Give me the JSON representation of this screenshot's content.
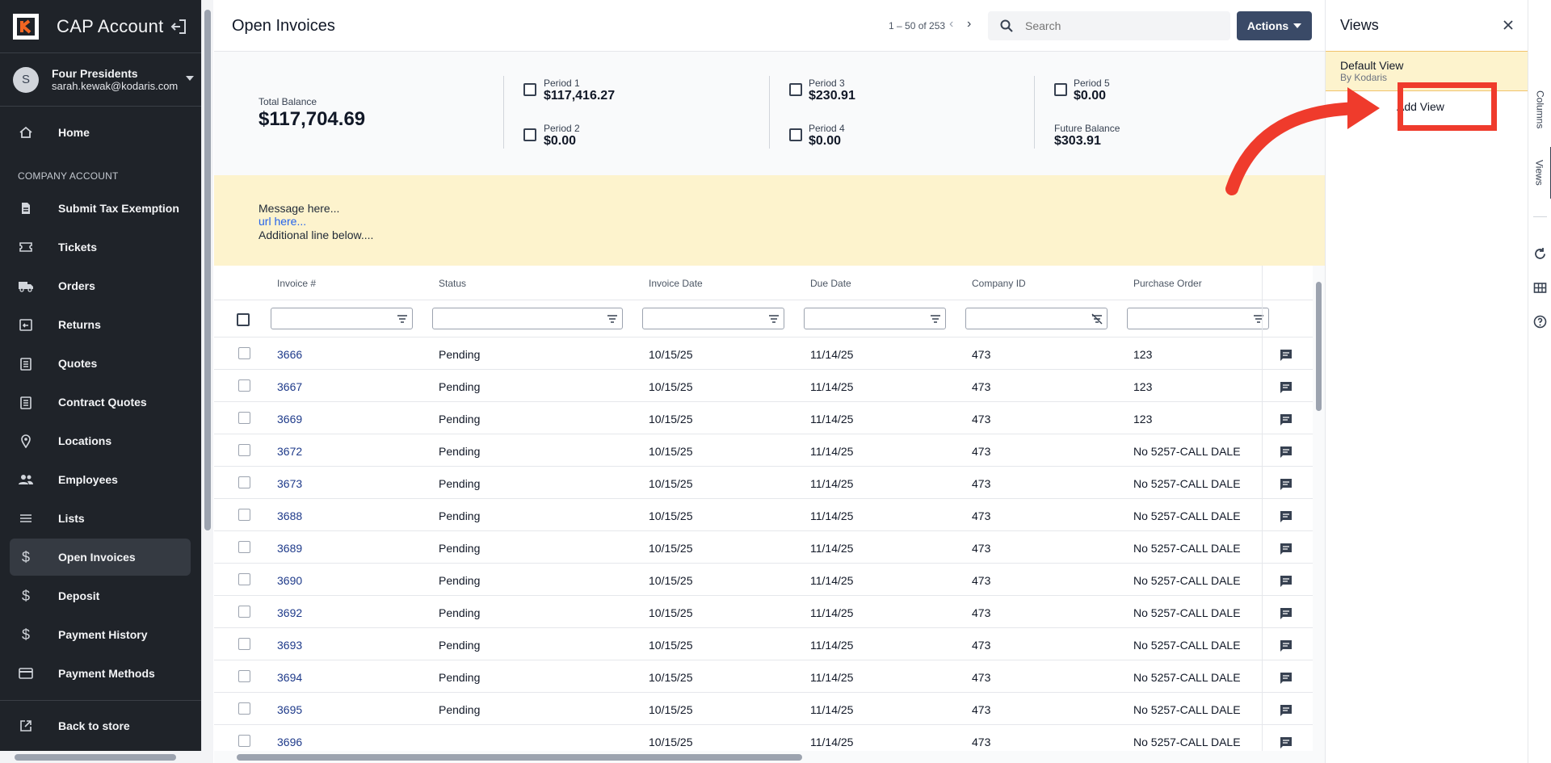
{
  "sidebar": {
    "app_title": "CAP Account",
    "user": {
      "initial": "S",
      "name": "Four Presidents",
      "email": "sarah.kewak@kodaris.com"
    },
    "home_label": "Home",
    "section_label": "COMPANY ACCOUNT",
    "items": [
      {
        "label": "Submit Tax Exemption",
        "icon": "document-icon"
      },
      {
        "label": "Tickets",
        "icon": "ticket-icon"
      },
      {
        "label": "Orders",
        "icon": "truck-icon"
      },
      {
        "label": "Returns",
        "icon": "return-icon"
      },
      {
        "label": "Quotes",
        "icon": "clipboard-icon"
      },
      {
        "label": "Contract Quotes",
        "icon": "clipboard-icon"
      },
      {
        "label": "Locations",
        "icon": "location-pin-icon"
      },
      {
        "label": "Employees",
        "icon": "people-icon"
      },
      {
        "label": "Lists",
        "icon": "list-icon"
      },
      {
        "label": "Open Invoices",
        "icon": "dollar-icon",
        "active": true
      },
      {
        "label": "Deposit",
        "icon": "dollar-icon"
      },
      {
        "label": "Payment History",
        "icon": "dollar-icon"
      },
      {
        "label": "Payment Methods",
        "icon": "credit-card-icon"
      }
    ],
    "back_label": "Back to store"
  },
  "topbar": {
    "title": "Open Invoices",
    "pager": "1 – 50 of 253",
    "search_placeholder": "Search",
    "actions_label": "Actions"
  },
  "summary": {
    "total_label": "Total Balance",
    "total_value": "$117,704.69",
    "period1_label": "Period 1",
    "period1_value": "$117,416.27",
    "period2_label": "Period 2",
    "period2_value": "$0.00",
    "period3_label": "Period 3",
    "period3_value": "$230.91",
    "period4_label": "Period 4",
    "period4_value": "$0.00",
    "period5_label": "Period 5",
    "period5_value": "$0.00",
    "future_label": "Future Balance",
    "future_value": "$303.91"
  },
  "message": {
    "line1": "Message here...",
    "link": "url here...",
    "line3": "Additional line below...."
  },
  "table": {
    "columns": [
      "Invoice #",
      "Status",
      "Invoice Date",
      "Due Date",
      "Company ID",
      "Purchase Order"
    ],
    "rows": [
      {
        "invoice": "3666",
        "status": "Pending",
        "invoice_date": "10/15/25",
        "due_date": "11/14/25",
        "company_id": "473",
        "po": "123"
      },
      {
        "invoice": "3667",
        "status": "Pending",
        "invoice_date": "10/15/25",
        "due_date": "11/14/25",
        "company_id": "473",
        "po": "123"
      },
      {
        "invoice": "3669",
        "status": "Pending",
        "invoice_date": "10/15/25",
        "due_date": "11/14/25",
        "company_id": "473",
        "po": "123"
      },
      {
        "invoice": "3672",
        "status": "Pending",
        "invoice_date": "10/15/25",
        "due_date": "11/14/25",
        "company_id": "473",
        "po": "No 5257-CALL DALE"
      },
      {
        "invoice": "3673",
        "status": "Pending",
        "invoice_date": "10/15/25",
        "due_date": "11/14/25",
        "company_id": "473",
        "po": "No 5257-CALL DALE"
      },
      {
        "invoice": "3688",
        "status": "Pending",
        "invoice_date": "10/15/25",
        "due_date": "11/14/25",
        "company_id": "473",
        "po": "No 5257-CALL DALE"
      },
      {
        "invoice": "3689",
        "status": "Pending",
        "invoice_date": "10/15/25",
        "due_date": "11/14/25",
        "company_id": "473",
        "po": "No 5257-CALL DALE"
      },
      {
        "invoice": "3690",
        "status": "Pending",
        "invoice_date": "10/15/25",
        "due_date": "11/14/25",
        "company_id": "473",
        "po": "No 5257-CALL DALE"
      },
      {
        "invoice": "3692",
        "status": "Pending",
        "invoice_date": "10/15/25",
        "due_date": "11/14/25",
        "company_id": "473",
        "po": "No 5257-CALL DALE"
      },
      {
        "invoice": "3693",
        "status": "Pending",
        "invoice_date": "10/15/25",
        "due_date": "11/14/25",
        "company_id": "473",
        "po": "No 5257-CALL DALE"
      },
      {
        "invoice": "3694",
        "status": "Pending",
        "invoice_date": "10/15/25",
        "due_date": "11/14/25",
        "company_id": "473",
        "po": "No 5257-CALL DALE"
      },
      {
        "invoice": "3695",
        "status": "Pending",
        "invoice_date": "10/15/25",
        "due_date": "11/14/25",
        "company_id": "473",
        "po": "No 5257-CALL DALE"
      },
      {
        "invoice": "3696",
        "status": "",
        "invoice_date": "10/15/25",
        "due_date": "11/14/25",
        "company_id": "473",
        "po": "No 5257-CALL DALE"
      }
    ]
  },
  "views_panel": {
    "title": "Views",
    "default_view_name": "Default View",
    "default_view_by": "By Kodaris",
    "add_view_label": "Add View"
  },
  "rail": {
    "columns_label": "Columns",
    "views_label": "Views"
  },
  "colors": {
    "sidebar_bg": "#1f2329",
    "accent_button": "#3a4a67",
    "message_bg": "#fdf3cd",
    "annotation_red": "#ef3b2c",
    "logo_orange": "#f26522"
  }
}
